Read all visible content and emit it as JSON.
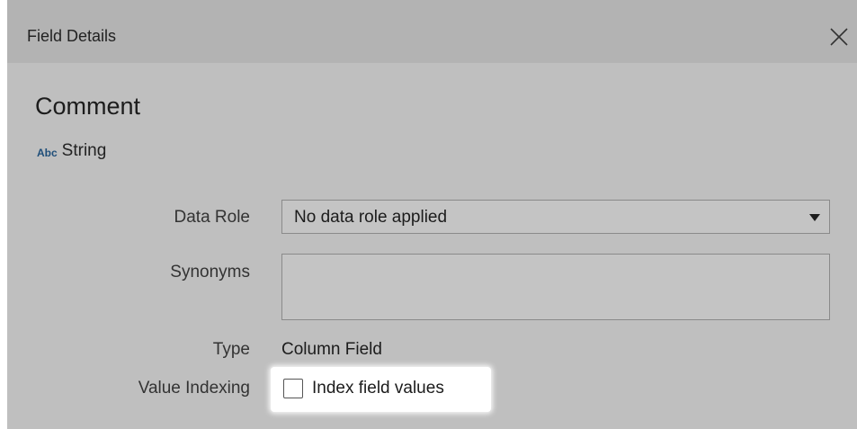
{
  "dialog": {
    "title": "Field Details",
    "close_icon": "close-icon"
  },
  "field": {
    "name": "Comment",
    "type_icon": "Abc",
    "type_label": "String"
  },
  "form": {
    "data_role": {
      "label": "Data Role",
      "value": "No data role applied"
    },
    "synonyms": {
      "label": "Synonyms",
      "value": ""
    },
    "type": {
      "label": "Type",
      "value": "Column Field"
    },
    "value_indexing": {
      "label": "Value Indexing",
      "checkbox_label": "Index field values",
      "checked": false
    }
  },
  "colors": {
    "dialog_bg": "#bfbfbf",
    "titlebar_bg": "#b3b3b3",
    "type_icon": "#1f4e79",
    "highlight": "#ffffff"
  }
}
